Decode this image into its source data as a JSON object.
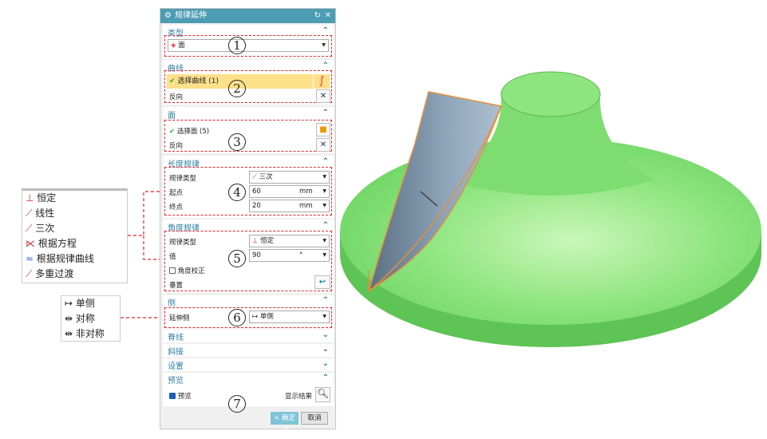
{
  "dialog": {
    "title": "规律延伸",
    "reset_icon": "reset-icon",
    "close_icon": "close-icon"
  },
  "type": {
    "header": "类型",
    "value": "面"
  },
  "curve": {
    "header": "曲线",
    "select": "选择曲线 (1)",
    "reverse": "反向"
  },
  "face": {
    "header": "面",
    "select": "选择面 (5)",
    "reverse": "反向"
  },
  "length_law": {
    "header": "长度规律",
    "law_type_label": "规律类型",
    "law_type": "三次",
    "start_label": "起点",
    "start_value": "60",
    "start_unit": "mm",
    "end_label": "终点",
    "end_value": "20",
    "end_unit": "mm"
  },
  "angle_law": {
    "header": "角度规律",
    "law_type_label": "规律类型",
    "law_type": "恒定",
    "value_label": "值",
    "value": "90",
    "unit": "°",
    "angle_correct": "角度校正",
    "angle_correct_checked": false,
    "perpendicular": "垂置"
  },
  "side": {
    "header": "侧",
    "extend_label": "延伸侧",
    "extend_value": "单侧"
  },
  "collapsed": [
    "脊线",
    "斜接",
    "设置"
  ],
  "preview": {
    "header": "预览",
    "checkbox": "预览",
    "checked": true,
    "show_result": "显示结果"
  },
  "buttons": {
    "ok": "< 确定 >",
    "cancel": "取消"
  },
  "callouts": [
    "1",
    "2",
    "3",
    "4",
    "5",
    "6",
    "7"
  ],
  "law_options": [
    "恒定",
    "线性",
    "三次",
    "根据方程",
    "根据规律曲线",
    "多重过渡"
  ],
  "side_options": [
    "单侧",
    "对称",
    "非对称"
  ],
  "colors": {
    "accent": "#4c9cb3",
    "highlight": "#fde08a",
    "callout": "#e8222a",
    "model_green": "#86e07a"
  }
}
